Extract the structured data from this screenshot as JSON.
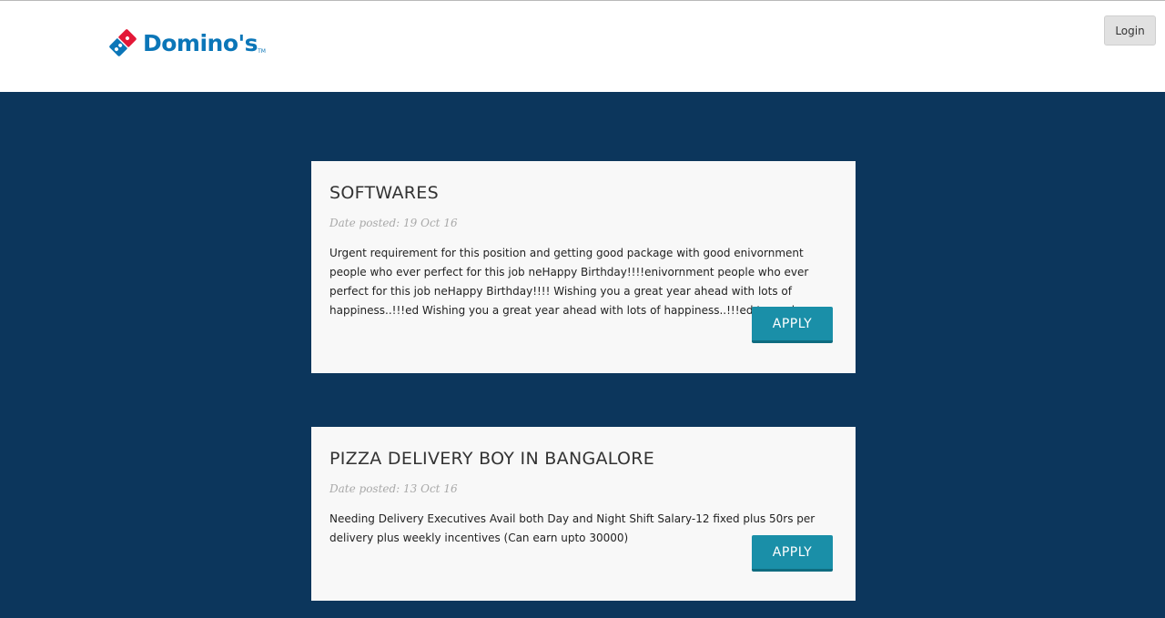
{
  "header": {
    "logo_text": "Domino's",
    "logo_tm": "TM",
    "login_label": "Login"
  },
  "jobs": [
    {
      "title": "SOFTWARES",
      "date": "Date posted: 19 Oct 16",
      "description": "Urgent requirement for this position and getting good package with good enivornment people who ever perfect for this job neHappy Birthday!!!!enivornment people who ever perfect for this job neHappy Birthday!!!! Wishing you a great year ahead with lots of happiness..!!!ed Wishing you a great year ahead with lots of happiness..!!!ed to apply",
      "apply_label": "APPLY"
    },
    {
      "title": "PIZZA DELIVERY BOY IN BANGALORE",
      "date": "Date posted: 13 Oct 16",
      "description": "Needing Delivery Executives Avail both Day and Night Shift Salary-12 fixed plus 50rs per delivery plus weekly incentives (Can earn upto 30000)",
      "apply_label": "APPLY"
    }
  ],
  "colors": {
    "page_background": "#0c365c",
    "brand_blue": "#0b76b8",
    "brand_red": "#e31837",
    "apply_button": "#1a8fa8"
  },
  "icons": {
    "logo": "dominos-domino-icon"
  }
}
